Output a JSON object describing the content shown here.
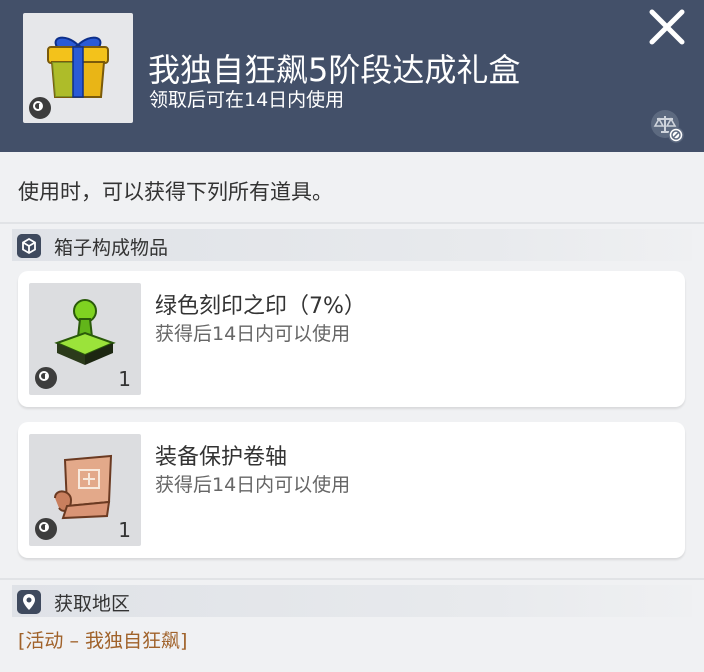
{
  "header": {
    "title": "我独自狂飙5阶段达成礼盒",
    "subtitle": "领取后可在14日内使用"
  },
  "description": "使用时，可以获得下列所有道具。",
  "box_section": {
    "label": "箱子构成物品",
    "items": [
      {
        "name": "绿色刻印之印（7%）",
        "sub": "获得后14日内可以使用",
        "count": "1",
        "icon": "green-stamp-icon"
      },
      {
        "name": "装备保护卷轴",
        "sub": "获得后14日内可以使用",
        "count": "1",
        "icon": "scroll-icon"
      }
    ]
  },
  "location_section": {
    "label": "获取地区",
    "value": "[活动 – 我独自狂飙]"
  },
  "colors": {
    "header_bg": "#435069",
    "location_text": "#a0622a"
  }
}
